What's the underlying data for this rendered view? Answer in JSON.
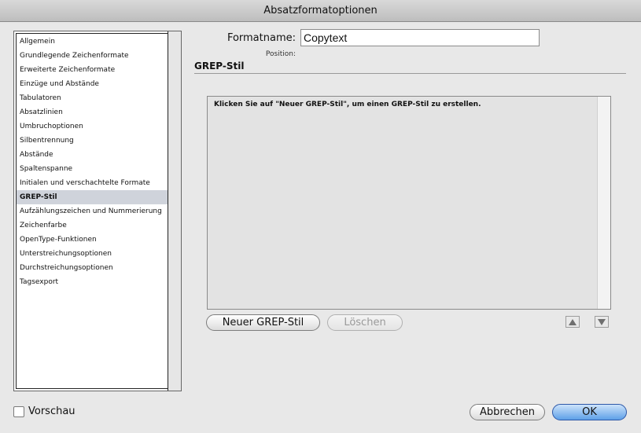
{
  "window": {
    "title": "Absatzformatoptionen"
  },
  "sidebar": {
    "items": [
      {
        "label": "Allgemein"
      },
      {
        "label": "Grundlegende Zeichenformate"
      },
      {
        "label": "Erweiterte Zeichenformate"
      },
      {
        "label": "Einzüge und Abstände"
      },
      {
        "label": "Tabulatoren"
      },
      {
        "label": "Absatzlinien"
      },
      {
        "label": "Umbruchoptionen"
      },
      {
        "label": "Silbentrennung"
      },
      {
        "label": "Abstände"
      },
      {
        "label": "Spaltenspanne"
      },
      {
        "label": "Initialen und verschachtelte Formate"
      },
      {
        "label": "GREP-Stil",
        "selected": true
      },
      {
        "label": "Aufzählungszeichen und Nummerierung"
      },
      {
        "label": "Zeichenfarbe"
      },
      {
        "label": "OpenType-Funktionen"
      },
      {
        "label": "Unterstreichungsoptionen"
      },
      {
        "label": "Durchstreichungsoptionen"
      },
      {
        "label": "Tagsexport"
      }
    ]
  },
  "format": {
    "label": "Formatname:",
    "value": "Copytext",
    "position_label": "Position:"
  },
  "grep": {
    "section_title": "GREP-Stil",
    "hint": "Klicken Sie auf \"Neuer GREP-Stil\", um einen GREP-Stil zu erstellen.",
    "new_button": "Neuer GREP-Stil",
    "delete_button": "Löschen"
  },
  "footer": {
    "preview_label": "Vorschau",
    "cancel_button": "Abbrechen",
    "ok_button": "OK"
  }
}
